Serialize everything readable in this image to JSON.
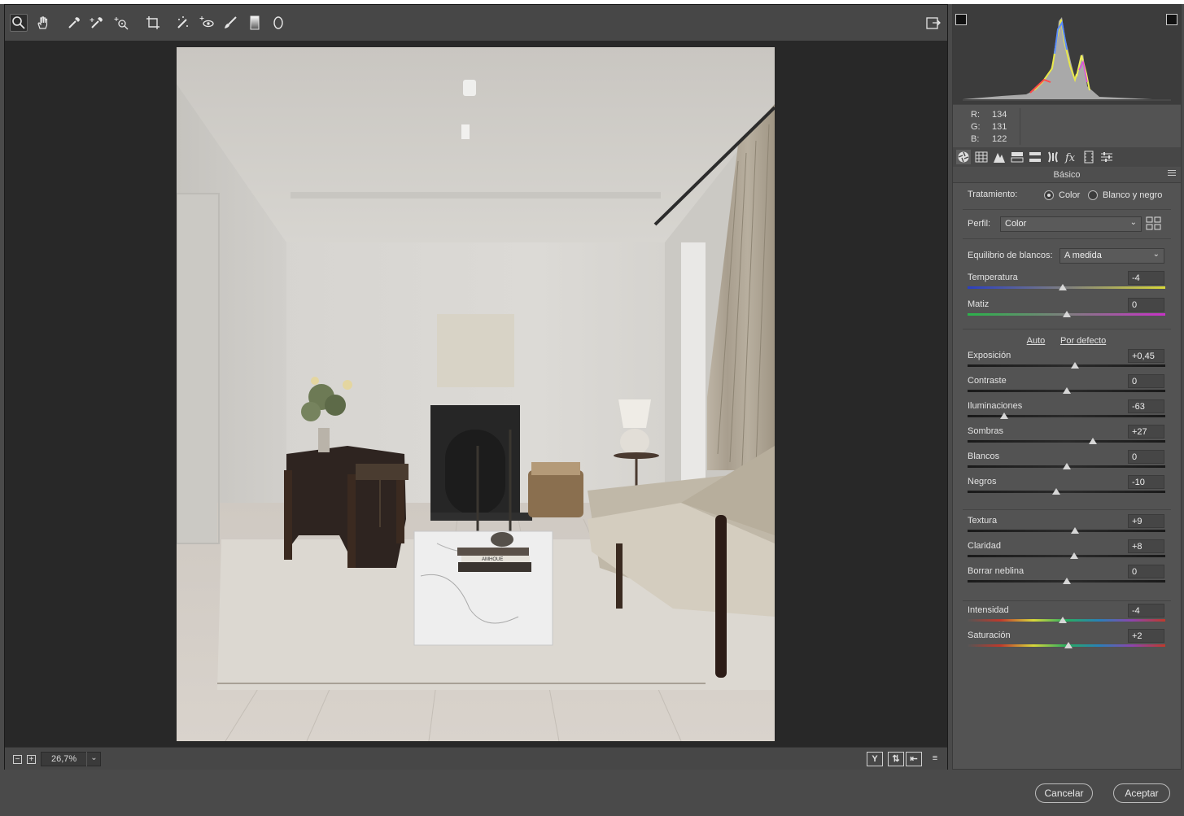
{
  "toolbar": {
    "tools": [
      "zoom-icon",
      "hand-icon",
      "eyedropper-icon",
      "color-sampler-icon",
      "targeted-adjustment-icon",
      "crop-icon",
      "spot-removal-icon",
      "red-eye-icon",
      "brush-icon",
      "graduated-filter-icon",
      "radial-filter-icon"
    ],
    "open_icon": "open-preferences-icon"
  },
  "zoom": {
    "minus": "−",
    "plus": "+",
    "value": "26,7%"
  },
  "view_buttons": [
    "Y",
    "⇅",
    "⇤",
    "≡"
  ],
  "rgb": {
    "r_label": "R:",
    "r": "134",
    "g_label": "G:",
    "g": "131",
    "b_label": "B:",
    "b": "122"
  },
  "panel": {
    "title": "Básico",
    "treatment_label": "Tratamiento:",
    "treatment_color": "Color",
    "treatment_bw": "Blanco y negro",
    "profile_label": "Perfil:",
    "profile_value": "Color",
    "wb_label": "Equilibrio de blancos:",
    "wb_value": "A medida",
    "auto": "Auto",
    "default": "Por defecto"
  },
  "sliders": [
    {
      "label": "Temperatura",
      "value": "-4",
      "pos": 0.48,
      "track": "temp"
    },
    {
      "label": "Matiz",
      "value": "0",
      "pos": 0.5,
      "track": "tint"
    },
    {
      "label": "Exposición",
      "value": "+0,45",
      "pos": 0.545,
      "track": "plain"
    },
    {
      "label": "Contraste",
      "value": "0",
      "pos": 0.5,
      "track": "plain"
    },
    {
      "label": "Iluminaciones",
      "value": "-63",
      "pos": 0.185,
      "track": "plain"
    },
    {
      "label": "Sombras",
      "value": "+27",
      "pos": 0.635,
      "track": "plain"
    },
    {
      "label": "Blancos",
      "value": "0",
      "pos": 0.5,
      "track": "plain"
    },
    {
      "label": "Negros",
      "value": "-10",
      "pos": 0.45,
      "track": "plain"
    },
    {
      "label": "Textura",
      "value": "+9",
      "pos": 0.545,
      "track": "plain"
    },
    {
      "label": "Claridad",
      "value": "+8",
      "pos": 0.54,
      "track": "plain"
    },
    {
      "label": "Borrar neblina",
      "value": "0",
      "pos": 0.5,
      "track": "plain"
    },
    {
      "label": "Intensidad",
      "value": "-4",
      "pos": 0.48,
      "track": "sat"
    },
    {
      "label": "Saturación",
      "value": "+2",
      "pos": 0.51,
      "track": "sat"
    }
  ],
  "footer": {
    "cancel": "Cancelar",
    "accept": "Aceptar"
  },
  "photo": {
    "book1": "AMHOUE",
    "book2": ""
  }
}
